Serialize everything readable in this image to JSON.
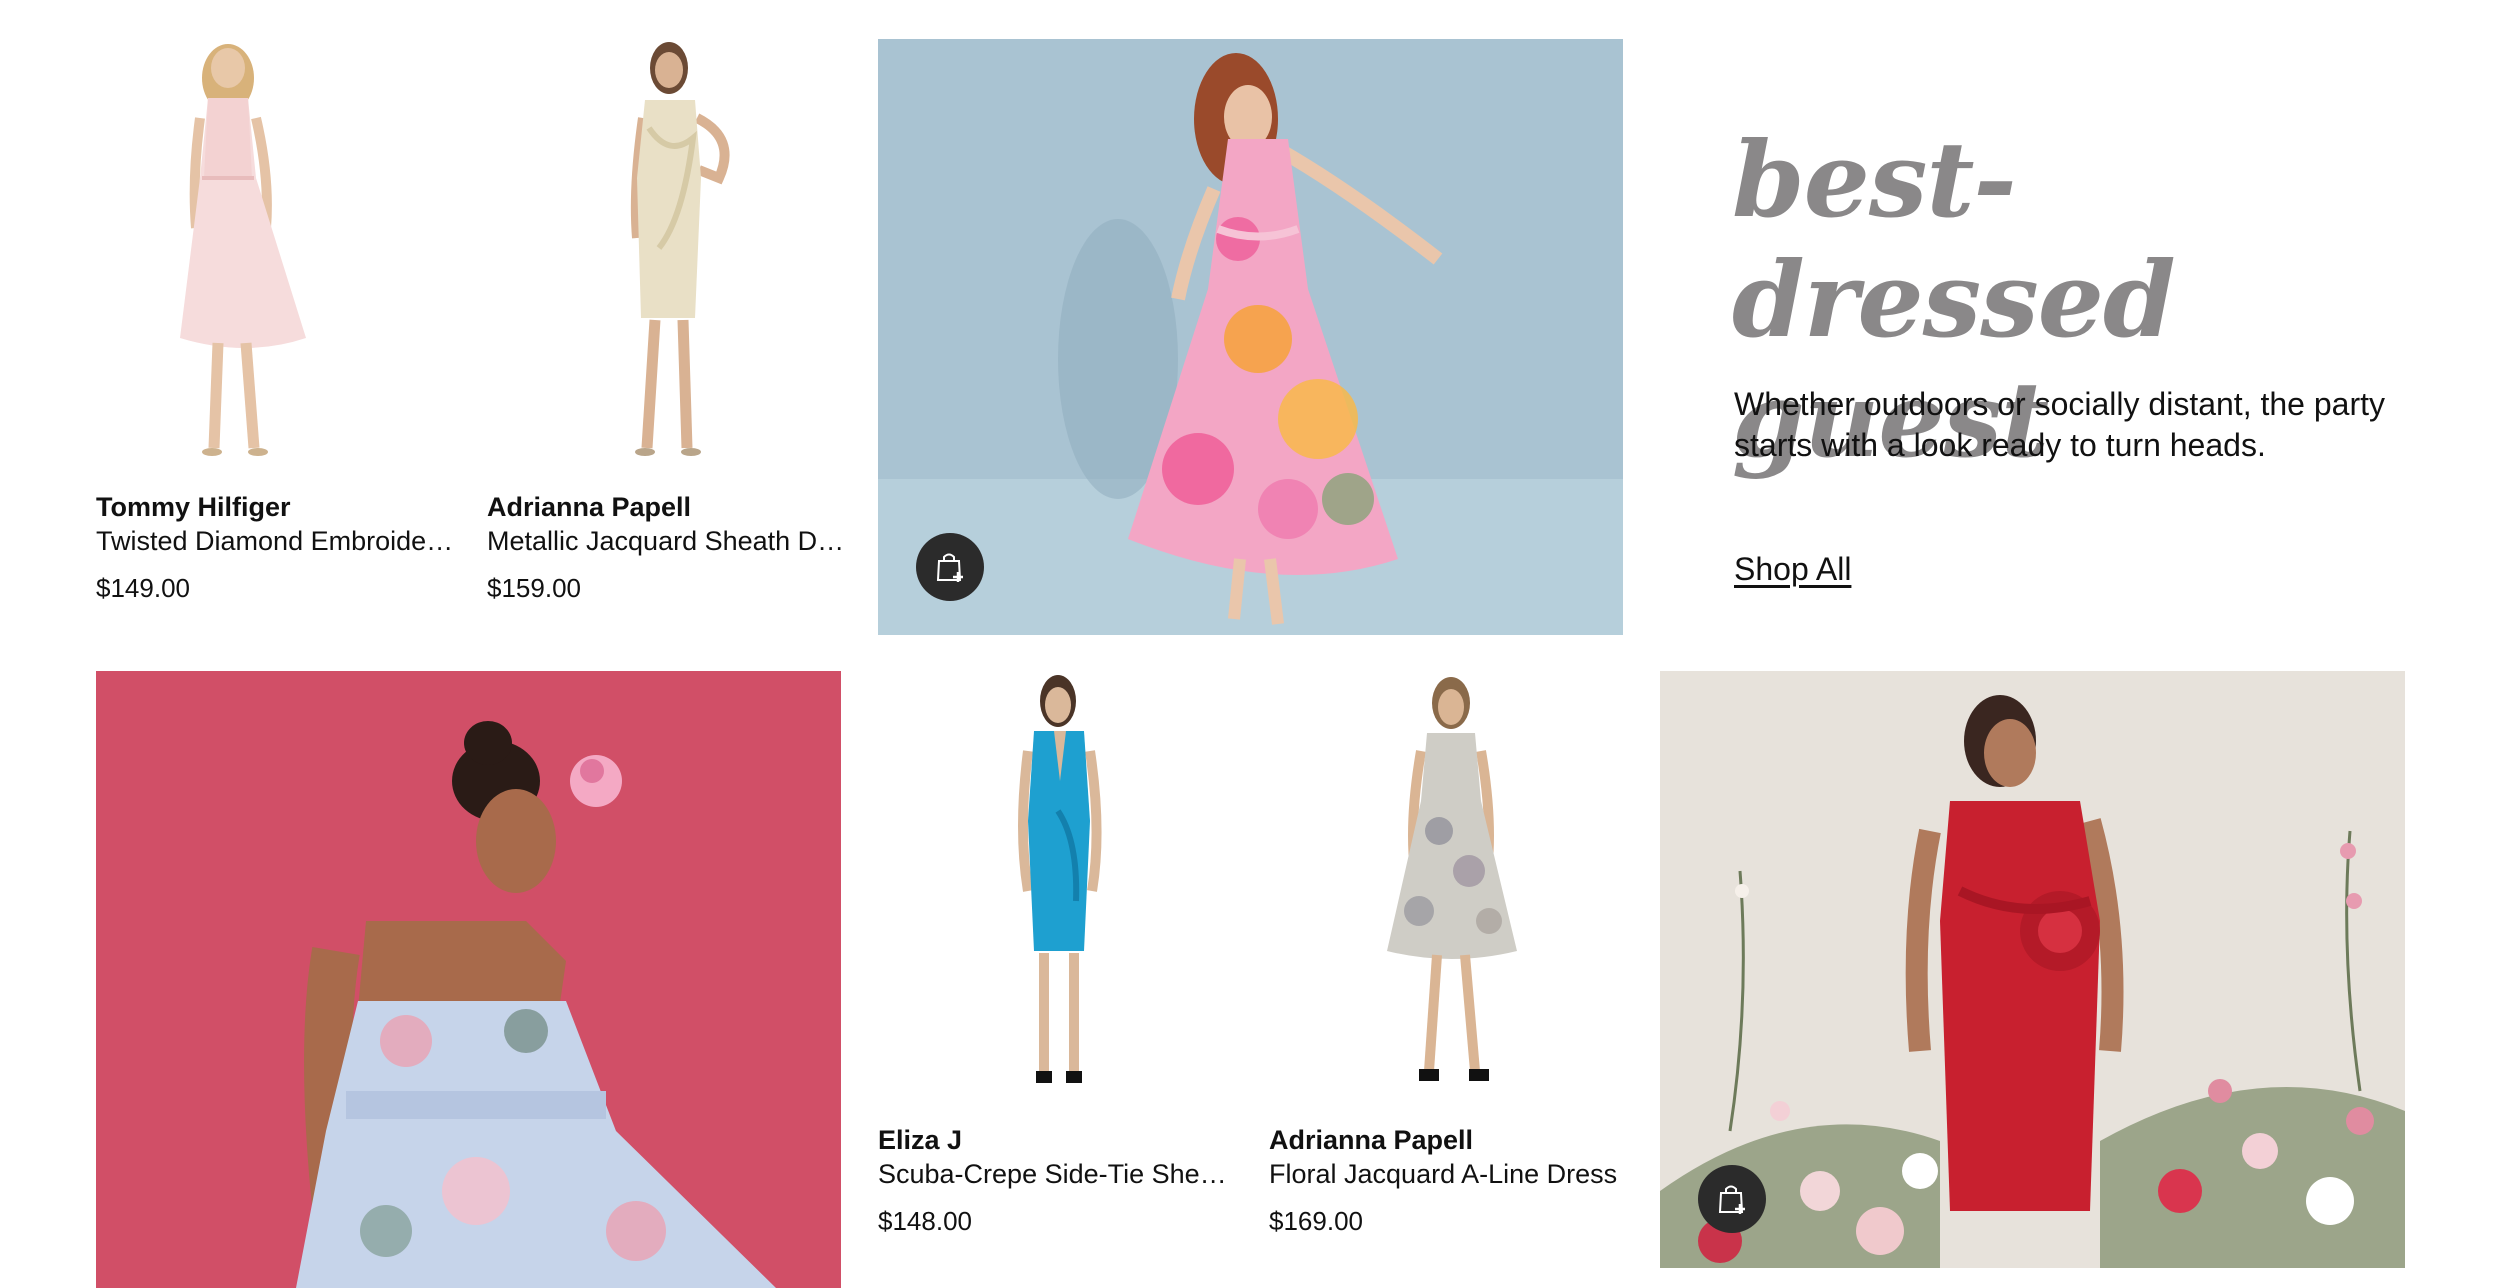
{
  "products": [
    {
      "brand": "Tommy Hilfiger",
      "name": "Twisted Diamond Embroidered Dress",
      "price": "$149.00"
    },
    {
      "brand": "Adrianna Papell",
      "name": "Metallic Jacquard Sheath Dress",
      "price": "$159.00"
    },
    {
      "brand": "Eliza J",
      "name": "Scuba-Crepe Side-Tie Sheath Dress",
      "price": "$148.00"
    },
    {
      "brand": "Adrianna Papell",
      "name": "Floral Jacquard A-Line Dress",
      "price": "$169.00"
    }
  ],
  "promo": {
    "headline_line1": "best-dressed",
    "headline_line2": "guest",
    "description": "Whether outdoors or socially distant, the party starts with a look ready to turn heads.",
    "cta": "Shop All"
  },
  "icons": {
    "quick_add": "shopping-bag-plus-icon"
  },
  "colors": {
    "headline": "#8a8889",
    "hero_blue_bg": "#a9c3d2",
    "hero_pink_bg": "#d14f67",
    "hero_cream_bg": "#e7e2db",
    "dress_red": "#c8202f",
    "dress_blue": "#1ea0d0",
    "button_dark": "#2b2b2b"
  }
}
